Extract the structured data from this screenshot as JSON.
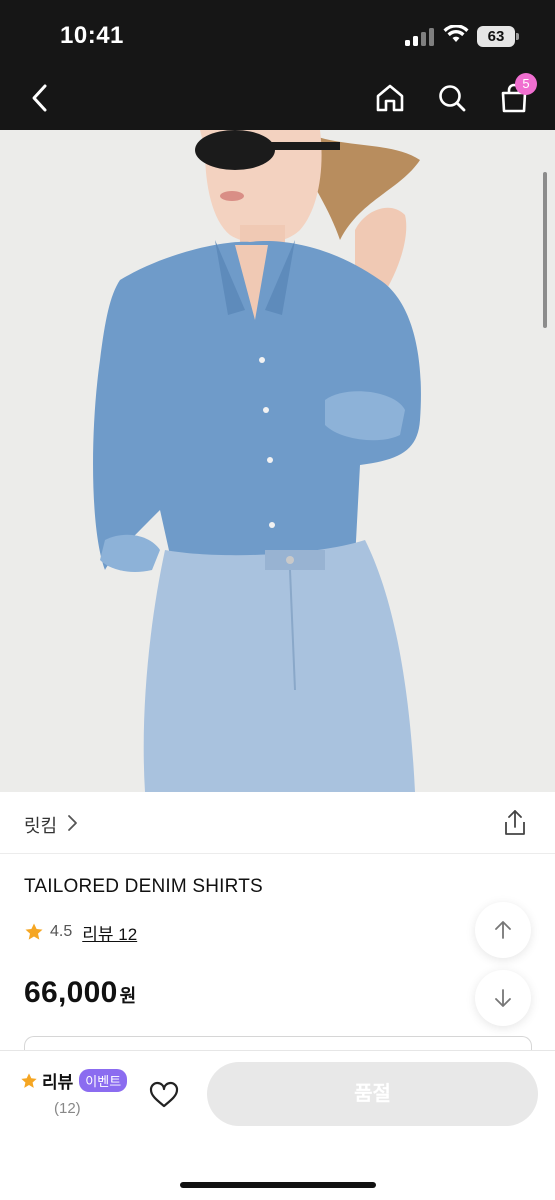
{
  "status_bar": {
    "time": "10:41",
    "battery": "63"
  },
  "nav": {
    "cart_count": "5",
    "icons": [
      "chevron-left-icon",
      "home-icon",
      "search-icon",
      "shopping-bag-icon"
    ]
  },
  "product": {
    "brand": "릿킴",
    "title": "TAILORED DENIM SHIRTS",
    "rating": "4.5",
    "review_link": "리뷰 12",
    "price": "66,000",
    "currency": "원",
    "image_alt": "model wearing a denim shirt and jeans"
  },
  "bottom_bar": {
    "review_label": "리뷰",
    "event_badge": "이벤트",
    "review_count": "(12)",
    "soldout_label": "품절"
  },
  "colors": {
    "topbar": "#161616",
    "badge": "#f06fd0",
    "event": "#8b6cf0",
    "star": "#f5a623",
    "soldout_bg": "#e8e8e8"
  }
}
